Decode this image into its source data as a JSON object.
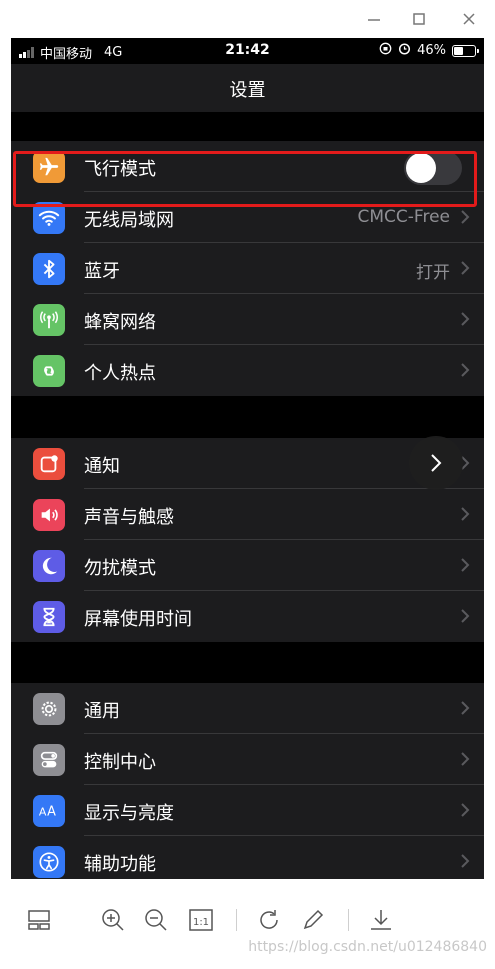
{
  "window": {
    "controls": [
      "minimize-icon",
      "maximize-icon",
      "close-icon"
    ]
  },
  "statusbar": {
    "carrier": "中国移动",
    "network": "4G",
    "time": "21:42",
    "battery": "46%"
  },
  "navbar": {
    "title": "设置"
  },
  "groups": [
    {
      "items": [
        {
          "label": "飞行模式",
          "value": "",
          "icon": "airplane-icon",
          "color": "#f09a37",
          "toggle": "off"
        },
        {
          "label": "无线局域网",
          "value": "CMCC-Free",
          "icon": "wifi-icon",
          "color": "#3478f6"
        },
        {
          "label": "蓝牙",
          "value": "打开",
          "icon": "bluetooth-icon",
          "color": "#3478f6"
        },
        {
          "label": "蜂窝网络",
          "value": "",
          "icon": "cellular-icon",
          "color": "#65c466"
        },
        {
          "label": "个人热点",
          "value": "",
          "icon": "hotspot-icon",
          "color": "#65c466"
        }
      ]
    },
    {
      "items": [
        {
          "label": "通知",
          "value": "",
          "icon": "notifications-icon",
          "color": "#eb4e3d"
        },
        {
          "label": "声音与触感",
          "value": "",
          "icon": "sound-icon",
          "color": "#eb445a"
        },
        {
          "label": "勿扰模式",
          "value": "",
          "icon": "moon-icon",
          "color": "#5e5ce6"
        },
        {
          "label": "屏幕使用时间",
          "value": "",
          "icon": "hourglass-icon",
          "color": "#5e5ce6"
        }
      ]
    },
    {
      "items": [
        {
          "label": "通用",
          "value": "",
          "icon": "gear-icon",
          "color": "#8e8e93"
        },
        {
          "label": "控制中心",
          "value": "",
          "icon": "switches-icon",
          "color": "#8e8e93"
        },
        {
          "label": "显示与亮度",
          "value": "",
          "icon": "text-size-icon",
          "color": "#3478f6"
        },
        {
          "label": "辅助功能",
          "value": "",
          "icon": "accessibility-icon",
          "color": "#3478f6"
        }
      ]
    }
  ],
  "toolbar": {
    "buttons": [
      "layout-icon",
      "zoom-in-icon",
      "zoom-out-icon",
      "actual-size-icon",
      "rotate-icon",
      "edit-icon",
      "download-icon"
    ],
    "actual_size_label": "1:1",
    "watermark": "https://blog.csdn.net/u012486840"
  }
}
